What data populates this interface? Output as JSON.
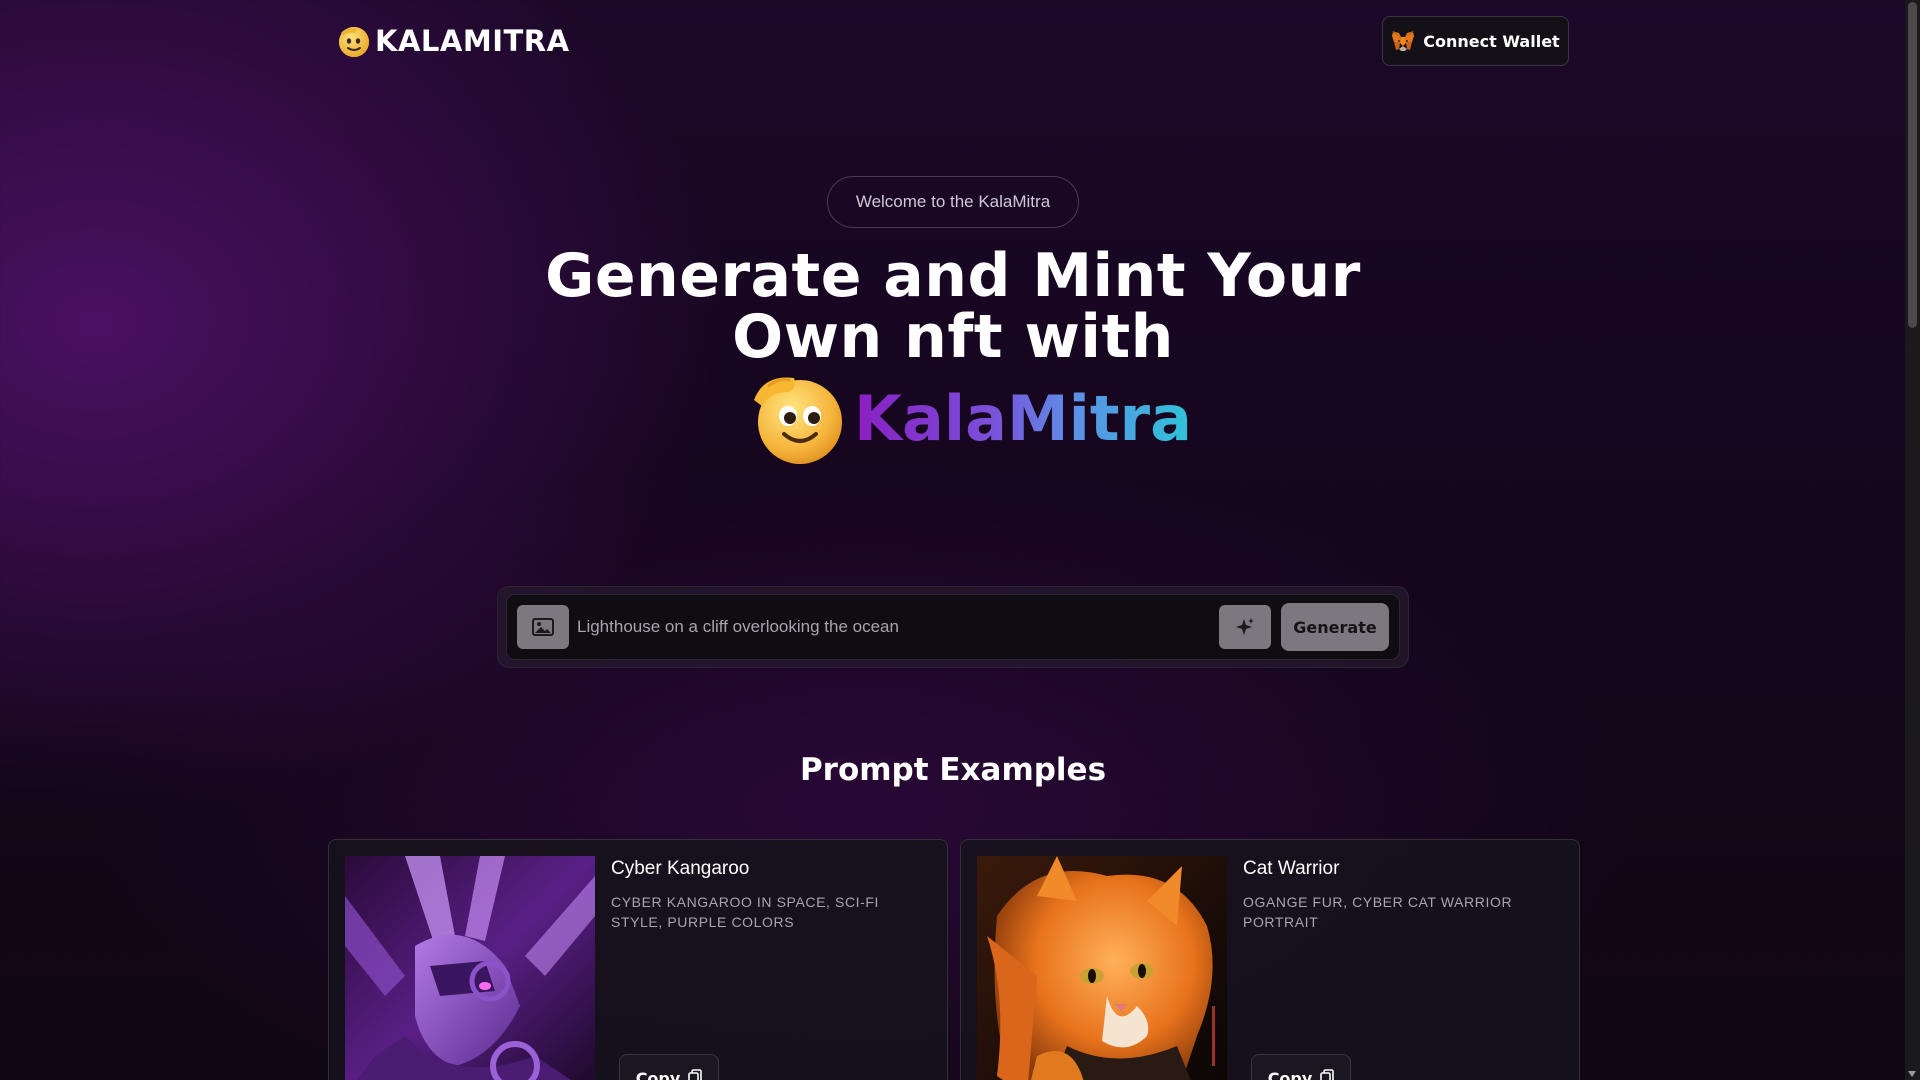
{
  "header": {
    "logo_text": "KALAMITRA",
    "connect_wallet_label": "Connect Wallet"
  },
  "hero": {
    "welcome_pill": "Welcome to the KalaMitra",
    "title_line1": "Generate and Mint Your",
    "title_line2": "Own nft with",
    "brand": "KalaMitra"
  },
  "prompt": {
    "placeholder": "Lighthouse on a cliff overlooking the ocean",
    "value": "",
    "generate_label": "Generate"
  },
  "examples": {
    "title": "Prompt Examples",
    "cards": [
      {
        "title": "Cyber Kangaroo",
        "description": "CYBER KANGAROO IN SPACE, SCI-FI STYLE, PURPLE COLORS",
        "copy_label": "Copy"
      },
      {
        "title": "Cat Warrior",
        "description": "OGANGE FUR, CYBER CAT WARRIOR PORTRAIT",
        "copy_label": "Copy"
      }
    ]
  },
  "colors": {
    "brand_gradient_start": "#8a1fc2",
    "brand_gradient_end": "#2ec4d8",
    "button_gray": "#7c7880",
    "background": "#16061f"
  },
  "icons": {
    "logo": "saluting-face-emoji-icon",
    "wallet": "metamask-fox-icon",
    "image_button": "image-icon",
    "enhance_button": "sparkle-icon",
    "copy": "copy-icon"
  }
}
